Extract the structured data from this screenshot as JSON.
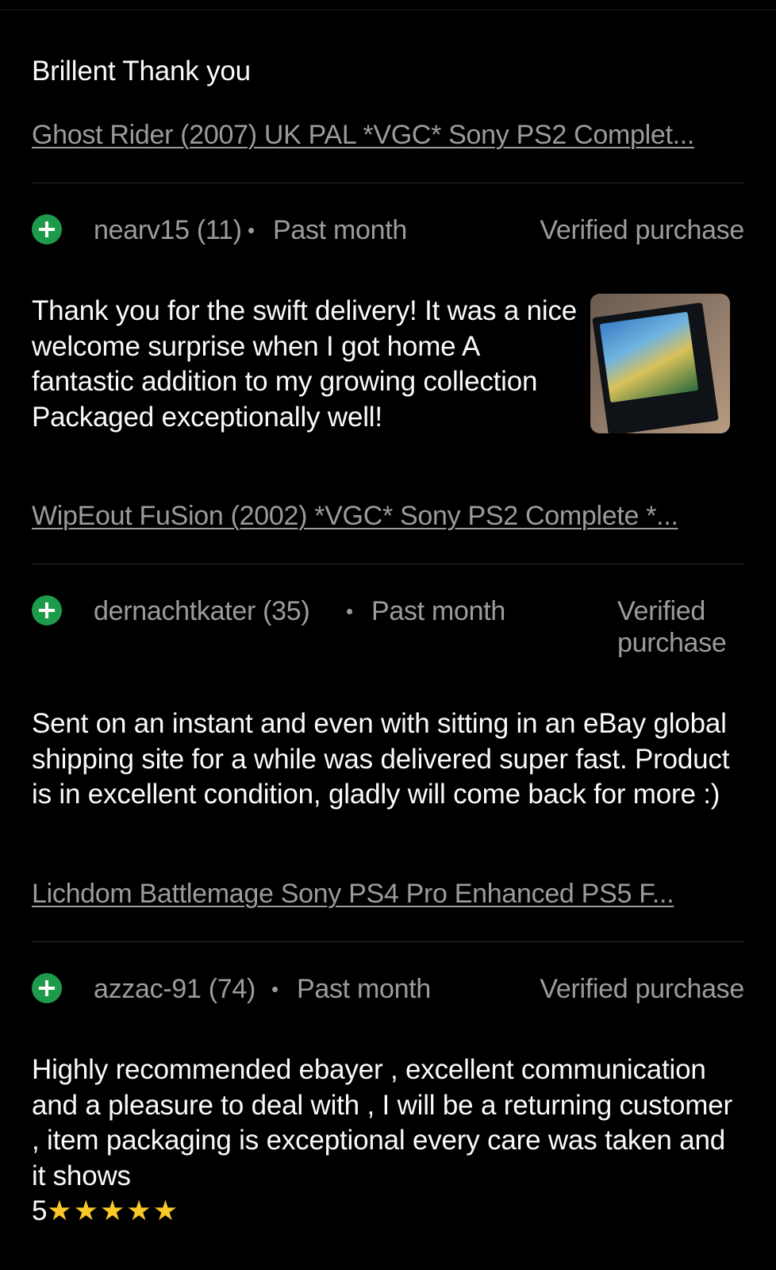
{
  "reviews": [
    {
      "comment": "Brillent Thank you",
      "item_link": "Ghost Rider (2007) UK PAL *VGC* Sony PS2 Complet..."
    },
    {
      "user": "nearv15 (11)",
      "when": "Past month",
      "verified": "Verified purchase",
      "comment": "Thank you for the swift delivery! It was a nice welcome surprise when I got home A fantastic addition to my growing collection Packaged exceptionally well!",
      "image_alt": "WipEout FuSion",
      "item_link": "WipEout FuSion (2002) *VGC* Sony PS2 Complete *..."
    },
    {
      "user": "dernachtkater (35)",
      "when": "Past month",
      "verified": "Verified purchase",
      "comment": "Sent on an instant and even with sitting in an eBay global shipping site for a while was delivered super fast. Product is in excellent condition, gladly will come back for more :)",
      "item_link": "Lichdom Battlemage Sony PS4 Pro Enhanced PS5 F..."
    },
    {
      "user": "azzac-91 (74)",
      "when": "Past month",
      "verified": "Verified purchase",
      "comment": "Highly recommended ebayer , excellent communication and a pleasure to deal with , I will be a returning customer , item packaging is exceptional every care was taken and it shows",
      "comment_tail": "5",
      "stars": "★★★★★"
    }
  ],
  "dot": "•",
  "positive_icon": "plus-circle-icon",
  "colors": {
    "positive": "#1d9a4a",
    "background": "#000000",
    "muted": "#9c9c9c"
  }
}
